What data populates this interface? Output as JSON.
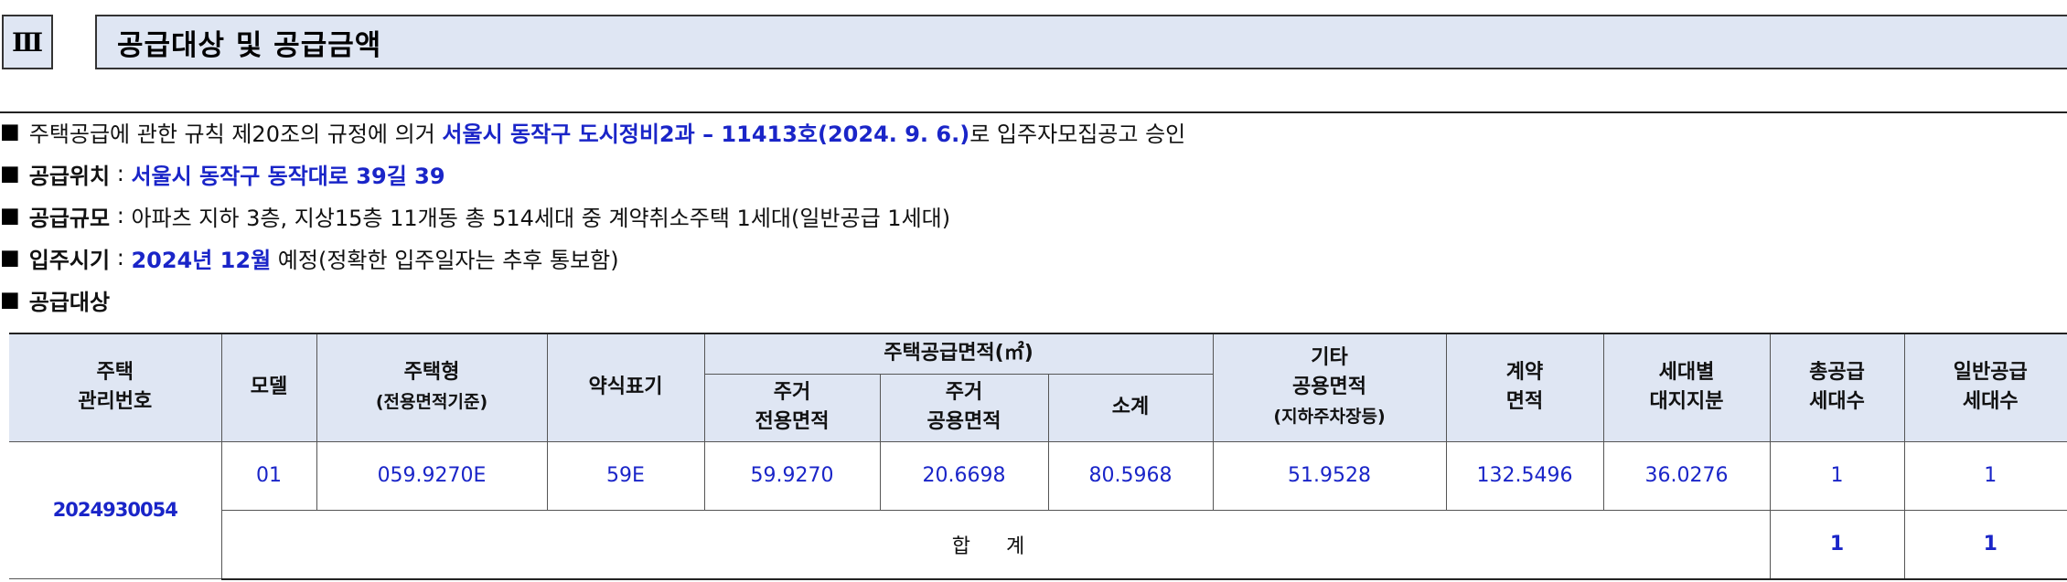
{
  "section": {
    "number": "Ⅲ",
    "title": "공급대상 및 공급금액"
  },
  "bullets": {
    "approval": {
      "prefix": "주택공급에 관한 규칙 제20조의 규정에 의거",
      "highlight": "서울시 동작구 도시정비2과 – 11413호(2024. 9. 6.)",
      "suffix": "로 입주자모집공고 승인"
    },
    "location": {
      "label": "공급위치",
      "sep": ":",
      "value": "서울시 동작구 동작대로 39길 39"
    },
    "scale": {
      "label": "공급규모",
      "sep": ":",
      "value": "아파츠 지하 3층, 지상15층 11개동 총 514세대 중 계약취소주택 1세대(일반공급 1세대)"
    },
    "move_in": {
      "label": "입주시기",
      "sep": ":",
      "highlight": "2024년 12월",
      "suffix": "예정(정확한 입주일자는 추후 통보함)"
    },
    "target": {
      "label": "공급대상"
    }
  },
  "table": {
    "headers": {
      "house_no_1": "주택",
      "house_no_2": "관리번호",
      "model": "모델",
      "type_1": "주택형",
      "type_2": "(전용면적기준)",
      "abbr": "약식표기",
      "area_group": "주택공급면적(㎡)",
      "private_1": "주거",
      "private_2": "전용면적",
      "common_1": "주거",
      "common_2": "공용면적",
      "subtotal": "소계",
      "other_1": "기타",
      "other_2": "공용면적",
      "other_3": "(지하주차장등)",
      "contract_1": "계약",
      "contract_2": "면적",
      "land_1": "세대별",
      "land_2": "대지지분",
      "total_units_1": "총공급",
      "total_units_2": "세대수",
      "general_units_1": "일반공급",
      "general_units_2": "세대수"
    },
    "row": {
      "house_no": "2024930054",
      "model": "01",
      "type": "059.9270E",
      "abbr": "59E",
      "private_area": "59.9270",
      "common_area": "20.6698",
      "subtotal": "80.5968",
      "other_common": "51.9528",
      "contract_area": "132.5496",
      "land_share": "36.0276",
      "total_units": "1",
      "general_units": "1"
    },
    "total": {
      "label": "합 계",
      "total_units": "1",
      "general_units": "1"
    }
  }
}
